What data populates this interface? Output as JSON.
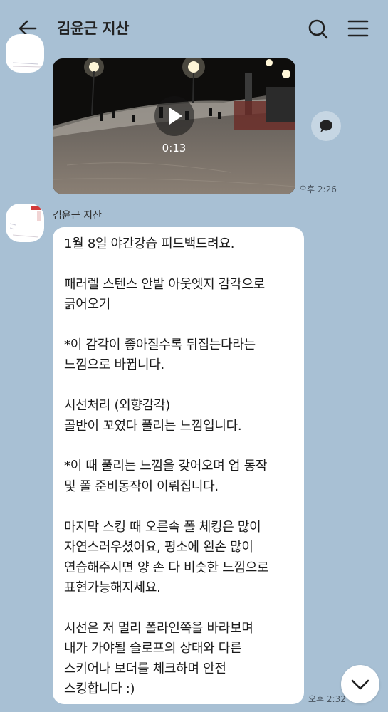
{
  "header": {
    "title": "김윤근 지산",
    "icons": [
      "back-arrow-icon",
      "search-icon",
      "hamburger-menu-icon"
    ]
  },
  "video_message": {
    "duration": "0:13",
    "time": "오후 2:26"
  },
  "text_message": {
    "sender": "김윤근 지산",
    "text": "1월 8일 야간강습 피드백드려요.\n\n패러렐 스텐스 안발 아웃엣지 감각으로\n긁어오기\n\n*이 감각이 좋아질수록 뒤집는다라는\n느낌으로 바뀝니다.\n\n시선처리 (외향감각)\n골반이 꼬였다 풀리는 느낌입니다.\n\n*이 때 풀리는 느낌을 갖어오며 업 동작\n및 폴 준비동작이 이뤄집니다.\n\n마지막 스킹 때 오른속 폴 체킹은 많이\n자연스러우셨어요, 평소에 왼손 많이\n연습해주시면 양 손 다 비슷한 느낌으로\n표현가능해지세요.\n\n시선은 저 멀리 폴라인쪽을 바라보며\n내가 가야될 슬로프의 상태와 다른\n스키어나 보더를 체크하며 안전\n스킹합니다 :)",
    "time": "오후 2:32"
  },
  "colors": {
    "background": "#a8c0d4",
    "bubble": "#ffffff"
  }
}
